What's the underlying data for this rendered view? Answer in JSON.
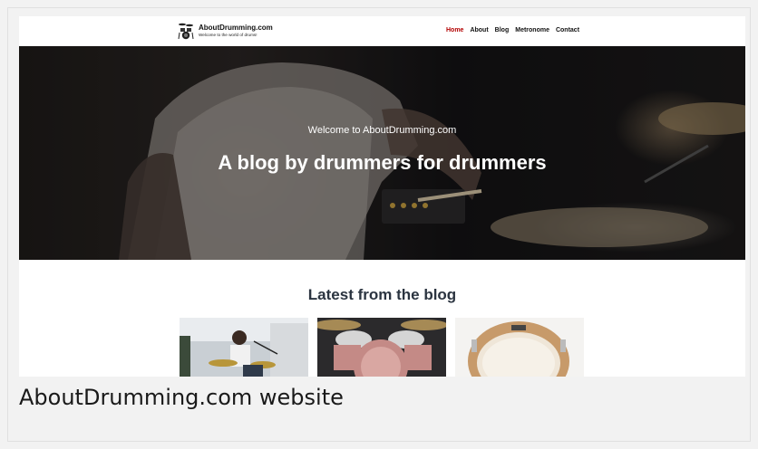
{
  "site": {
    "title": "AboutDrumming.com",
    "tagline": "Welcome to the world of drums!",
    "logo_icon": "drum-kit-icon"
  },
  "nav": {
    "items": [
      {
        "label": "Home",
        "active": true
      },
      {
        "label": "About",
        "active": false
      },
      {
        "label": "Blog",
        "active": false
      },
      {
        "label": "Metronome",
        "active": false
      },
      {
        "label": "Contact",
        "active": false
      }
    ],
    "active_color": "#b30000"
  },
  "hero": {
    "kicker": "Welcome to AboutDrumming.com",
    "title": "A blog by drummers for drummers"
  },
  "blog": {
    "heading": "Latest from the blog",
    "cards": [
      {
        "image": "drummer-performing-outdoors-photo"
      },
      {
        "image": "pink-drum-kit-photo"
      },
      {
        "image": "snare-drum-photo"
      }
    ]
  },
  "caption": "AboutDrumming.com website"
}
